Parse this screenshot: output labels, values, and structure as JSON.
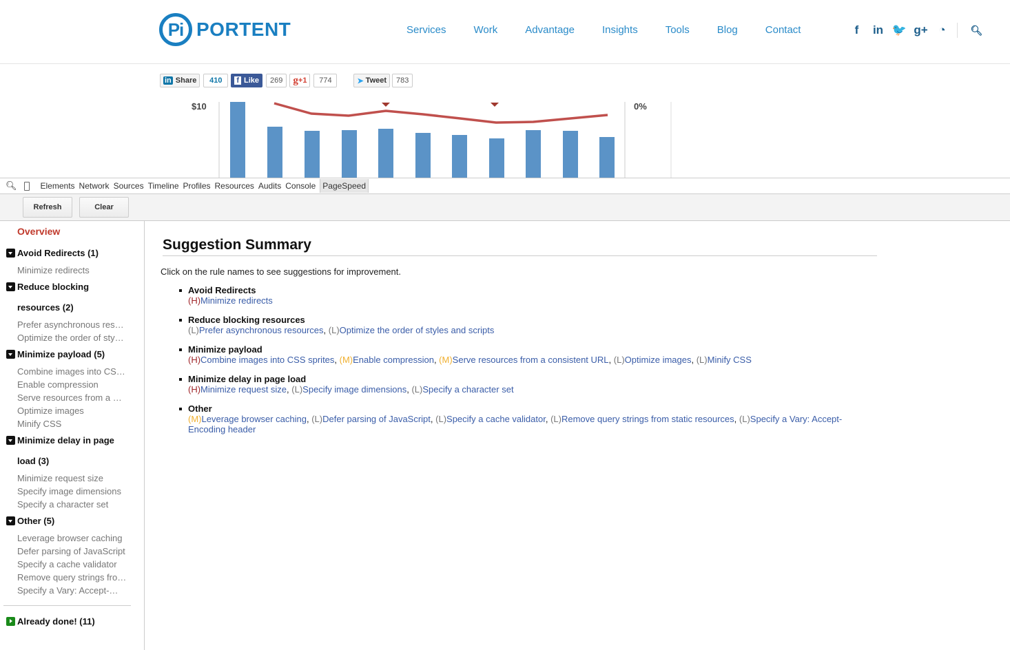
{
  "site": {
    "logo_mark": "Pi",
    "logo_text": "PORTENT",
    "nav": [
      "Services",
      "Work",
      "Advantage",
      "Insights",
      "Tools",
      "Blog",
      "Contact"
    ],
    "social_icons": [
      {
        "name": "facebook-icon",
        "glyph": "f"
      },
      {
        "name": "linkedin-icon",
        "glyph": "in"
      },
      {
        "name": "twitter-icon",
        "glyph": "🐦"
      },
      {
        "name": "google-plus-icon",
        "glyph": "g+"
      },
      {
        "name": "rss-icon",
        "glyph": "◔"
      }
    ],
    "share": {
      "linkedin_label": "Share",
      "linkedin_count": "410",
      "facebook_label": "Like",
      "facebook_count": "269",
      "gplus_label": "+1",
      "gplus_count": "774",
      "twitter_label": "Tweet",
      "twitter_count": "783"
    },
    "chart": {
      "left_tick": "$10",
      "right_tick": "0%",
      "bar_color": "#5b93c7",
      "line_color": "#c0504d"
    }
  },
  "devtools": {
    "tabs": [
      "Elements",
      "Network",
      "Sources",
      "Timeline",
      "Profiles",
      "Resources",
      "Audits",
      "Console",
      "PageSpeed"
    ],
    "active_tab": "PageSpeed",
    "refresh": "Refresh",
    "clear": "Clear"
  },
  "sidebar": {
    "overview": "Overview",
    "groups": [
      {
        "title": "Avoid Redirects (1)",
        "items": [
          "Minimize redirects"
        ]
      },
      {
        "title": "Reduce blocking resources (2)",
        "items": [
          "Prefer asynchronous res…",
          "Optimize the order of sty…"
        ]
      },
      {
        "title": "Minimize payload (5)",
        "items": [
          "Combine images into CS…",
          "Enable compression",
          "Serve resources from a …",
          "Optimize images",
          "Minify CSS"
        ]
      },
      {
        "title": "Minimize delay in page load (3)",
        "items": [
          "Minimize request size",
          "Specify image dimensions",
          "Specify a character set"
        ]
      },
      {
        "title": "Other (5)",
        "items": [
          "Leverage browser caching",
          "Defer parsing of JavaScript",
          "Specify a cache validator",
          "Remove query strings fro…",
          "Specify a Vary: Accept-…"
        ]
      }
    ],
    "done": "Already done! (11)"
  },
  "main": {
    "title": "Suggestion Summary",
    "intro": "Click on the rule names to see suggestions for improvement.",
    "rules": [
      {
        "heading": "Avoid Redirects",
        "items": [
          {
            "sev": "H",
            "label": "Minimize redirects"
          }
        ]
      },
      {
        "heading": "Reduce blocking resources",
        "items": [
          {
            "sev": "L",
            "label": "Prefer asynchronous resources"
          },
          {
            "sev": "L",
            "label": "Optimize the order of styles and scripts"
          }
        ]
      },
      {
        "heading": "Minimize payload",
        "items": [
          {
            "sev": "H",
            "label": "Combine images into CSS sprites"
          },
          {
            "sev": "M",
            "label": "Enable compression"
          },
          {
            "sev": "M",
            "label": "Serve resources from a consistent URL"
          },
          {
            "sev": "L",
            "label": "Optimize images"
          },
          {
            "sev": "L",
            "label": "Minify CSS"
          }
        ]
      },
      {
        "heading": "Minimize delay in page load",
        "items": [
          {
            "sev": "H",
            "label": "Minimize request size"
          },
          {
            "sev": "L",
            "label": "Specify image dimensions"
          },
          {
            "sev": "L",
            "label": "Specify a character set"
          }
        ]
      },
      {
        "heading": "Other",
        "items": [
          {
            "sev": "M",
            "label": "Leverage browser caching"
          },
          {
            "sev": "L",
            "label": "Defer parsing of JavaScript"
          },
          {
            "sev": "L",
            "label": "Specify a cache validator"
          },
          {
            "sev": "L",
            "label": "Remove query strings from static resources"
          },
          {
            "sev": "L",
            "label": "Specify a Vary: Accept-Encoding header"
          }
        ]
      }
    ]
  },
  "colors": {
    "brand": "#1a7fc1",
    "high": "#a0272b",
    "medium": "#f0b030",
    "low": "#777777",
    "link": "#3a5da8",
    "overview": "#c0392b"
  }
}
